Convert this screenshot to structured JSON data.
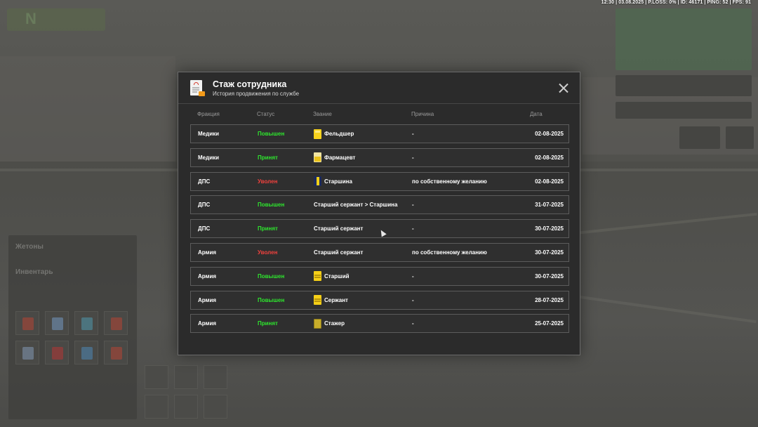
{
  "status_bar": "12:30 | 03.08.2025 | P.LOSS: 0% | ID: 46171 | PING: 52 | FPS: 91",
  "dialog": {
    "title": "Стаж сотрудника",
    "subtitle": "История продвижения по службе"
  },
  "columns": {
    "faction": "Фракция",
    "status": "Статус",
    "rank": "Звание",
    "reason": "Причина",
    "date": "Дата"
  },
  "rows": [
    {
      "faction": "Медики",
      "status": "Повышен",
      "status_color": "#2ee62e",
      "rank": "Фельдшер",
      "rank_icon": "yellow",
      "reason": "-",
      "date": "02-08-2025"
    },
    {
      "faction": "Медики",
      "status": "Принят",
      "status_color": "#2ee62e",
      "rank": "Фармацевт",
      "rank_icon": "pale",
      "reason": "-",
      "date": "02-08-2025"
    },
    {
      "faction": "ДПС",
      "status": "Уволен",
      "status_color": "#f0413d",
      "rank": "Старшина",
      "rank_icon": "navy",
      "reason": "по собственному желанию",
      "date": "02-08-2025"
    },
    {
      "faction": "ДПС",
      "status": "Повышен",
      "status_color": "#2ee62e",
      "rank": "Старший сержант > Старшина",
      "rank_icon": "",
      "reason": "-",
      "date": "31-07-2025"
    },
    {
      "faction": "ДПС",
      "status": "Принят",
      "status_color": "#2ee62e",
      "rank": "Старший сержант",
      "rank_icon": "",
      "reason": "-",
      "date": "30-07-2025"
    },
    {
      "faction": "Армия",
      "status": "Уволен",
      "status_color": "#f0413d",
      "rank": "Старший сержант",
      "rank_icon": "",
      "reason": "по собственному желанию",
      "date": "30-07-2025"
    },
    {
      "faction": "Армия",
      "status": "Повышен",
      "status_color": "#2ee62e",
      "rank": "Старший",
      "rank_icon": "stripes",
      "reason": "-",
      "date": "30-07-2025"
    },
    {
      "faction": "Армия",
      "status": "Повышен",
      "status_color": "#2ee62e",
      "rank": "Сержант",
      "rank_icon": "stripes",
      "reason": "-",
      "date": "28-07-2025"
    },
    {
      "faction": "Армия",
      "status": "Принят",
      "status_color": "#2ee62e",
      "rank": "Стажер",
      "rank_icon": "olive",
      "reason": "-",
      "date": "25-07-2025"
    }
  ],
  "background_hud": {
    "left_panel": [
      "Жетоны",
      "Инвентарь"
    ]
  }
}
